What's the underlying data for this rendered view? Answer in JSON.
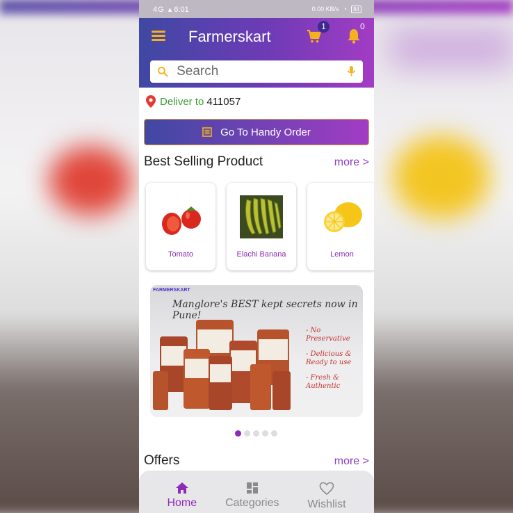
{
  "status_bar": {
    "time": "6:01",
    "network": "4G",
    "speed": "0.00 KB/s",
    "battery": "84"
  },
  "header": {
    "title": "Farmerskart",
    "cart_count": "1",
    "notification_count": "0"
  },
  "search": {
    "placeholder": "Search"
  },
  "delivery": {
    "label": "Deliver to",
    "pincode": "411057"
  },
  "handy_order": {
    "label": "Go To Handy Order"
  },
  "best_selling": {
    "title": "Best Selling Product",
    "more": "more >",
    "products": [
      {
        "name": "Tomato"
      },
      {
        "name": "Elachi Banana"
      },
      {
        "name": "Lemon"
      }
    ]
  },
  "banner": {
    "headline": "Manglore's BEST kept secrets now in Pune!",
    "points": [
      "- No Preservative",
      "- Delicious & Ready to use",
      "- Fresh & Authentic"
    ],
    "total_slides": 5,
    "active_slide": 1
  },
  "offers": {
    "title": "Offers",
    "more": "more >"
  },
  "bottom_nav": {
    "items": [
      {
        "label": "Home",
        "icon": "home-icon",
        "active": true
      },
      {
        "label": "Categories",
        "icon": "grid-icon",
        "active": false
      },
      {
        "label": "Wishlist",
        "icon": "heart-icon",
        "active": false
      }
    ]
  },
  "colors": {
    "accent": "#8e2bb8",
    "header_start": "#3f48a3",
    "header_end": "#a23cc4",
    "icon_yellow": "#f6b21c",
    "deliver_green": "#3c9a36"
  }
}
